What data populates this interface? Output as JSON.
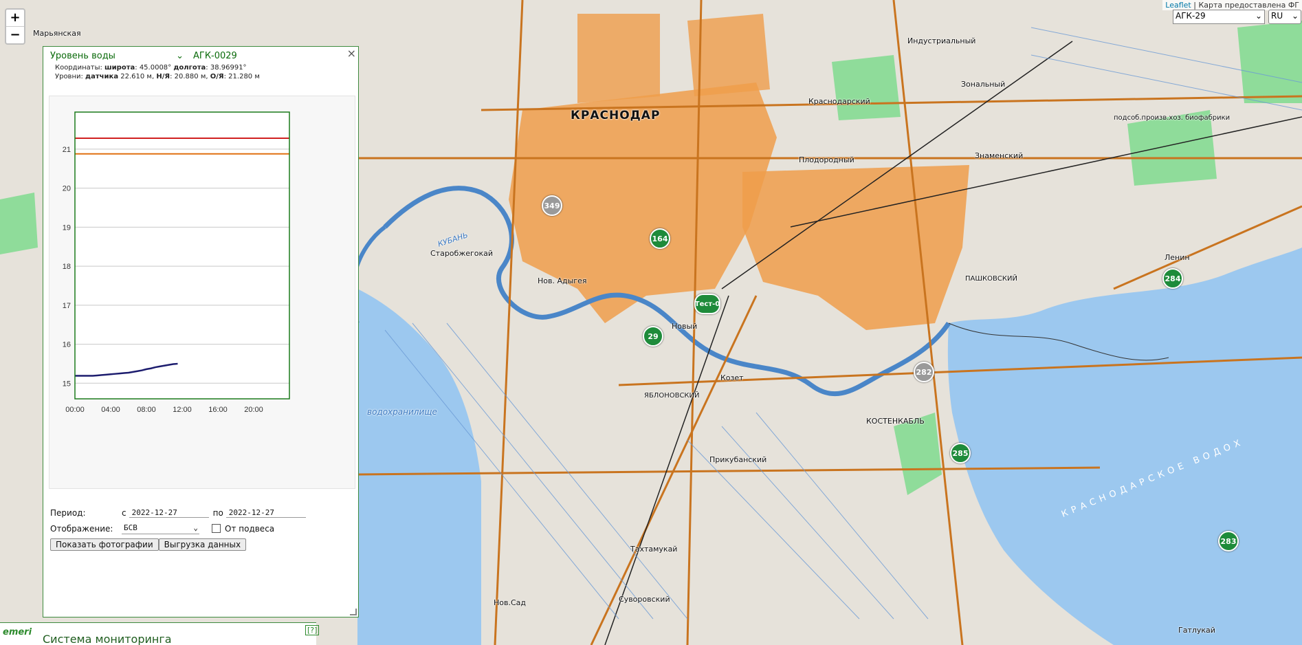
{
  "map": {
    "zoom_in": "+",
    "zoom_out": "−",
    "attribution_link": "Leaflet",
    "attribution_text": "| Карта предоставлена ФГ",
    "station_selected": "АГК-29",
    "language_selected": "RU",
    "labels": {
      "krasnodar": "КРАСНОДАР",
      "industrialny": "Индустриальный",
      "zonalny": "Зональный",
      "krasnodarsky": "Краснодарский",
      "plodorodny": "Плодородный",
      "znamensky": "Знаменский",
      "podsob": "подсоб.произв.хоз. биофабрики",
      "lenin": "Ленин",
      "pashkovsky": "ПАШКОВСКИЙ",
      "starobzhegokay": "Старобжегокай",
      "nov_adygeya": "Нов. Адыгея",
      "novy": "Новый",
      "kozet": "Козет",
      "yablonovsky": "ЯБЛОНОВСКИЙ",
      "kostenkabl": "КОСТЕНКАБЛЬ",
      "prikubansky": "Прикубанский",
      "takhtamukay": "Тахтамукай",
      "suvorovsky": "Суворовский",
      "nov_sad": "Нов.Сад",
      "gatlukay": "Гатлукай",
      "maryanskaya": "Марьянская",
      "kuban": "КУБАНЬ",
      "reservoir_left": "водохранилище",
      "reservoir_sea": "КРАСНОДАРСКОЕ ВОДОХ"
    },
    "markers": [
      {
        "label": "349",
        "kind": "grey"
      },
      {
        "label": "164",
        "kind": "green"
      },
      {
        "label": "Тест-0",
        "kind": "green"
      },
      {
        "label": "29",
        "kind": "green"
      },
      {
        "label": "282",
        "kind": "grey"
      },
      {
        "label": "285",
        "kind": "green"
      },
      {
        "label": "284",
        "kind": "green"
      },
      {
        "label": "283",
        "kind": "green"
      }
    ]
  },
  "panel": {
    "close": "×",
    "parameter": "Уровень воды",
    "station": "АГК-0029",
    "coords_label": "Координаты:",
    "lat_label": "широта",
    "lat_value": "45.0008°",
    "lon_label": "долгота",
    "lon_value": "38.96991°",
    "levels_label": "Уровни:",
    "sensor_label": "датчика",
    "sensor_value": "22.610 м,",
    "nya_label": "Н/Я",
    "nya_value": "20.880 м,",
    "oya_label": "О/Я",
    "oya_value": "21.280 м",
    "period_label": "Период:",
    "from_label": "с",
    "date_from": "2022-12-27",
    "to_label": "по",
    "date_to": "2022-12-27",
    "display_label": "Отображение:",
    "display_value": "БСВ",
    "from_suspension_label": "От подвеса",
    "show_photos_button": "Показать фотографии",
    "export_button": "Выгрузка данных"
  },
  "brand": {
    "logo": "emeri",
    "title": "Система мониторинга",
    "help": "[?]"
  },
  "chart_data": {
    "type": "line",
    "x_ticks": [
      "00:00",
      "04:00",
      "08:00",
      "12:00",
      "16:00",
      "20:00"
    ],
    "y_ticks": [
      15,
      16,
      17,
      18,
      19,
      20,
      21
    ],
    "xlim": [
      0,
      24
    ],
    "ylim": [
      14.6,
      21.95
    ],
    "grid": true,
    "reference_lines": [
      {
        "y": 21.28,
        "color": "#d02020"
      },
      {
        "y": 20.88,
        "color": "#e07010"
      }
    ],
    "series": [
      {
        "color": "#1c1c6e",
        "x": [
          0,
          0.5,
          1,
          1.5,
          2,
          2.5,
          3,
          3.5,
          4,
          4.5,
          5,
          5.5,
          6,
          6.5,
          7,
          7.5,
          8,
          8.5,
          9,
          9.5,
          10,
          10.5,
          11,
          11.5
        ],
        "y": [
          15.19,
          15.19,
          15.19,
          15.19,
          15.19,
          15.2,
          15.21,
          15.22,
          15.23,
          15.24,
          15.25,
          15.26,
          15.27,
          15.29,
          15.31,
          15.33,
          15.36,
          15.38,
          15.41,
          15.43,
          15.45,
          15.47,
          15.49,
          15.5
        ]
      }
    ]
  }
}
